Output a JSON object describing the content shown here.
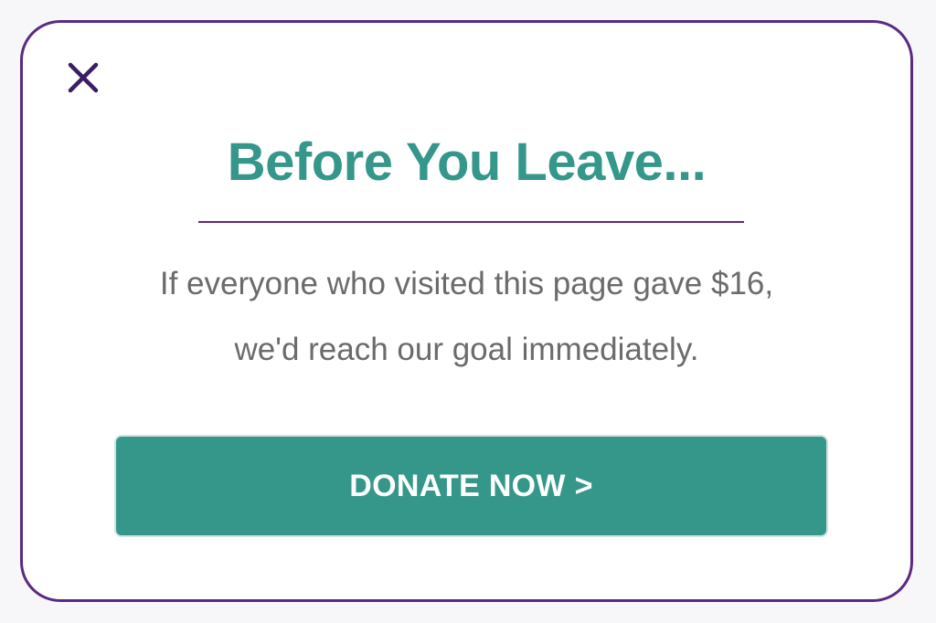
{
  "modal": {
    "close_icon": "close-icon",
    "title": "Before You Leave...",
    "message_line_1": "If everyone who visited this page gave $16,",
    "message_line_2": "we'd reach our goal immediately.",
    "donate_label": "DONATE NOW >"
  },
  "colors": {
    "accent_purple": "#5a2a83",
    "brand_teal": "#34978a",
    "text_gray": "#6b6b6b"
  }
}
